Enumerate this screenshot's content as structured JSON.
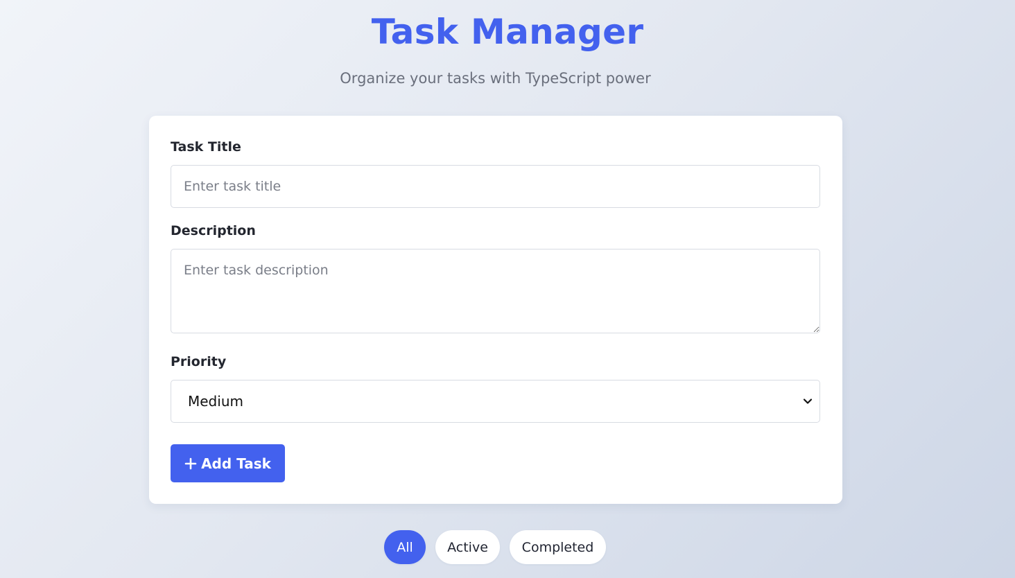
{
  "header": {
    "title": "Task Manager",
    "subtitle": "Organize your tasks with TypeScript power"
  },
  "form": {
    "title_label": "Task Title",
    "title_placeholder": "Enter task title",
    "title_value": "",
    "description_label": "Description",
    "description_placeholder": "Enter task description",
    "description_value": "",
    "priority_label": "Priority",
    "priority_selected": "Medium",
    "priority_icon": "chevron-down-icon",
    "add_button_icon": "plus-icon",
    "add_button_label": "Add Task"
  },
  "filters": {
    "items": [
      {
        "label": "All",
        "active": true
      },
      {
        "label": "Active",
        "active": false
      },
      {
        "label": "Completed",
        "active": false
      }
    ]
  },
  "colors": {
    "accent": "#4361ee",
    "card": "#ffffff",
    "subtitle": "#6a6f7c",
    "label": "#23262f"
  }
}
